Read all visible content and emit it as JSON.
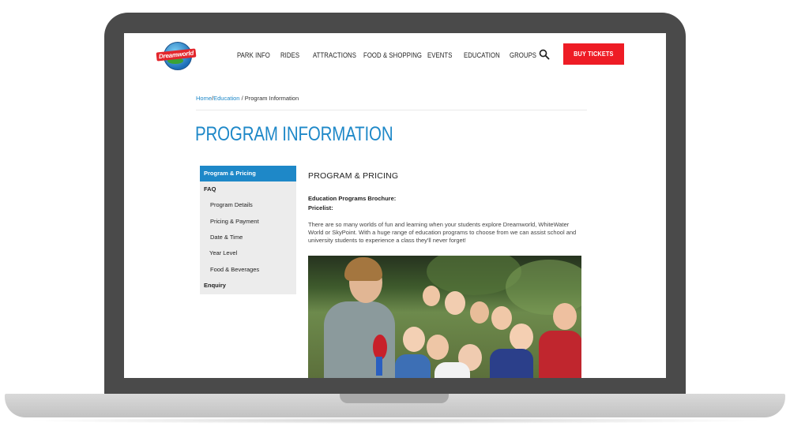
{
  "header": {
    "logo_text": "Dreamworld",
    "nav": [
      "PARK INFO",
      "RIDES",
      "ATTRACTIONS",
      "FOOD & SHOPPING",
      "EVENTS",
      "EDUCATION",
      "GROUPS"
    ],
    "buy_label": "BUY TICKETS",
    "search_icon": "search-icon",
    "accent_color": "#ee1c25"
  },
  "breadcrumb": {
    "home": "Home",
    "sep1": "/",
    "education": "Education",
    "sep2": "/",
    "current": "Program Information"
  },
  "page": {
    "title": "PROGRAM INFORMATION",
    "title_color": "#1e88c8"
  },
  "sidebar": {
    "items": [
      {
        "label": "Program & Pricing",
        "level": "top",
        "active": true
      },
      {
        "label": "FAQ",
        "level": "top"
      },
      {
        "label": "Program Details",
        "level": "sub"
      },
      {
        "label": "Pricing & Payment",
        "level": "sub"
      },
      {
        "label": "Date & Time",
        "level": "sub"
      },
      {
        "label": "Year Level",
        "level": "sub"
      },
      {
        "label": "Food & Beverages",
        "level": "sub"
      },
      {
        "label": "Enquiry",
        "level": "top"
      }
    ]
  },
  "content": {
    "section_title": "PROGRAM & PRICING",
    "brochure_label": "Education Programs Brochure:",
    "pricelist_label": "Pricelist:",
    "intro": "There are so many worlds of fun and learning when your students explore Dreamworld, WhiteWater World or SkyPoint. With a huge range of education programs to choose from we can assist school and university students to experience a class they'll never forget!"
  }
}
